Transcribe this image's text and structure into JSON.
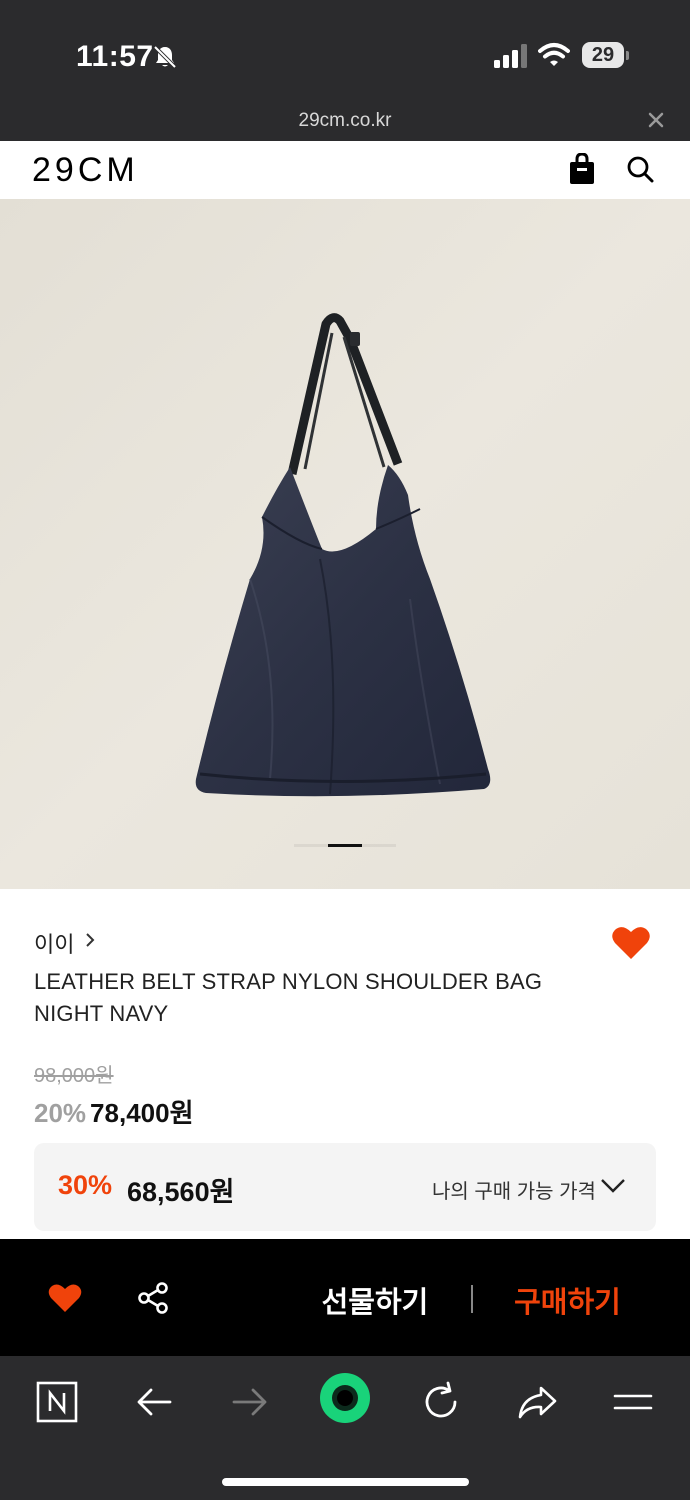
{
  "status_bar": {
    "time": "11:57",
    "battery": "29"
  },
  "browser": {
    "url": "29cm.co.kr"
  },
  "header": {
    "logo": "29CM"
  },
  "product": {
    "brand": "이이",
    "title": "LEATHER BELT STRAP NYLON SHOULDER BAG NIGHT NAVY",
    "original_price": "98,000원",
    "discount": "20%",
    "sale_price": "78,400원",
    "coupon": {
      "discount": "30%",
      "price": "68,560원",
      "label": "나의 구매 가능 가격"
    },
    "image_count": 3,
    "active_image": 1
  },
  "actions": {
    "gift": "선물하기",
    "buy": "구매하기"
  },
  "colors": {
    "accent": "#f0430b",
    "dark": "#2b2b2d"
  }
}
